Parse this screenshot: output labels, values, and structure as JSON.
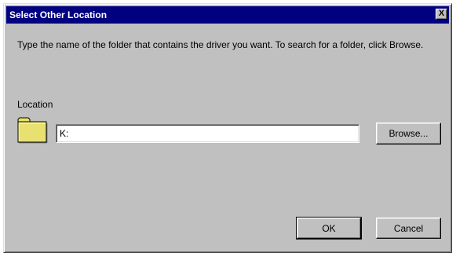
{
  "window": {
    "title": "Select Other Location",
    "close_glyph": "X"
  },
  "instructions": "Type the name of the folder that contains the driver you want. To search for a folder, click Browse.",
  "location": {
    "label": "Location",
    "value": "K:",
    "icon": "folder-icon"
  },
  "buttons": {
    "browse": "Browse...",
    "ok": "OK",
    "cancel": "Cancel"
  },
  "colors": {
    "titlebar": "#000080",
    "dialog_face": "#c0c0c0",
    "folder": "#e8e070"
  }
}
